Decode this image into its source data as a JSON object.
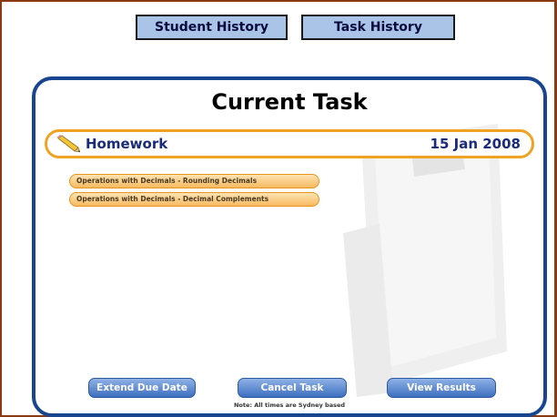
{
  "nav": {
    "student_history_label": "Student History",
    "task_history_label": "Task History"
  },
  "panel": {
    "title": "Current Task",
    "task": {
      "name": "Homework",
      "date": "15 Jan 2008",
      "icon": "pencil-icon"
    },
    "items": [
      {
        "label": "Operations with Decimals - Rounding Decimals"
      },
      {
        "label": "Operations with Decimals - Decimal Complements"
      }
    ],
    "actions": {
      "extend_label": "Extend Due Date",
      "cancel_label": "Cancel Task",
      "results_label": "View Results"
    },
    "note": "Note: All times are Sydney based"
  },
  "colors": {
    "frame_border": "#8a3a12",
    "panel_border": "#17458f",
    "accent_orange": "#f0a323",
    "nav_button_bg": "#a9c4e6",
    "action_button": "#3e6fbf"
  }
}
